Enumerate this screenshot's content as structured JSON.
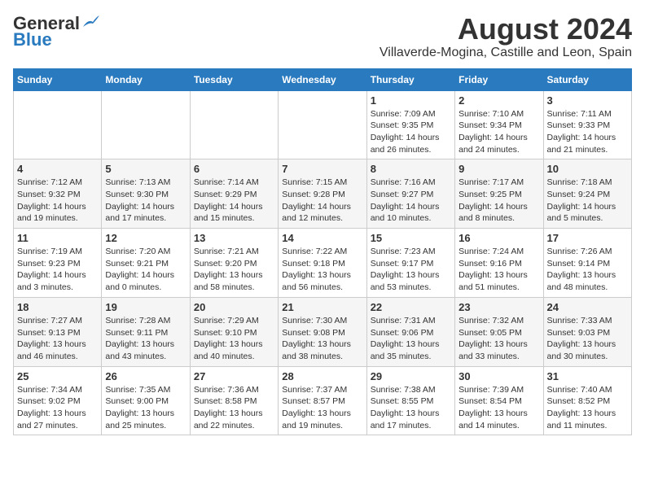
{
  "logo": {
    "general": "General",
    "blue": "Blue"
  },
  "title": "August 2024",
  "subtitle": "Villaverde-Mogina, Castille and Leon, Spain",
  "days_of_week": [
    "Sunday",
    "Monday",
    "Tuesday",
    "Wednesday",
    "Thursday",
    "Friday",
    "Saturday"
  ],
  "weeks": [
    [
      {
        "day": "",
        "info": ""
      },
      {
        "day": "",
        "info": ""
      },
      {
        "day": "",
        "info": ""
      },
      {
        "day": "",
        "info": ""
      },
      {
        "day": "1",
        "info": "Sunrise: 7:09 AM\nSunset: 9:35 PM\nDaylight: 14 hours and 26 minutes."
      },
      {
        "day": "2",
        "info": "Sunrise: 7:10 AM\nSunset: 9:34 PM\nDaylight: 14 hours and 24 minutes."
      },
      {
        "day": "3",
        "info": "Sunrise: 7:11 AM\nSunset: 9:33 PM\nDaylight: 14 hours and 21 minutes."
      }
    ],
    [
      {
        "day": "4",
        "info": "Sunrise: 7:12 AM\nSunset: 9:32 PM\nDaylight: 14 hours and 19 minutes."
      },
      {
        "day": "5",
        "info": "Sunrise: 7:13 AM\nSunset: 9:30 PM\nDaylight: 14 hours and 17 minutes."
      },
      {
        "day": "6",
        "info": "Sunrise: 7:14 AM\nSunset: 9:29 PM\nDaylight: 14 hours and 15 minutes."
      },
      {
        "day": "7",
        "info": "Sunrise: 7:15 AM\nSunset: 9:28 PM\nDaylight: 14 hours and 12 minutes."
      },
      {
        "day": "8",
        "info": "Sunrise: 7:16 AM\nSunset: 9:27 PM\nDaylight: 14 hours and 10 minutes."
      },
      {
        "day": "9",
        "info": "Sunrise: 7:17 AM\nSunset: 9:25 PM\nDaylight: 14 hours and 8 minutes."
      },
      {
        "day": "10",
        "info": "Sunrise: 7:18 AM\nSunset: 9:24 PM\nDaylight: 14 hours and 5 minutes."
      }
    ],
    [
      {
        "day": "11",
        "info": "Sunrise: 7:19 AM\nSunset: 9:23 PM\nDaylight: 14 hours and 3 minutes."
      },
      {
        "day": "12",
        "info": "Sunrise: 7:20 AM\nSunset: 9:21 PM\nDaylight: 14 hours and 0 minutes."
      },
      {
        "day": "13",
        "info": "Sunrise: 7:21 AM\nSunset: 9:20 PM\nDaylight: 13 hours and 58 minutes."
      },
      {
        "day": "14",
        "info": "Sunrise: 7:22 AM\nSunset: 9:18 PM\nDaylight: 13 hours and 56 minutes."
      },
      {
        "day": "15",
        "info": "Sunrise: 7:23 AM\nSunset: 9:17 PM\nDaylight: 13 hours and 53 minutes."
      },
      {
        "day": "16",
        "info": "Sunrise: 7:24 AM\nSunset: 9:16 PM\nDaylight: 13 hours and 51 minutes."
      },
      {
        "day": "17",
        "info": "Sunrise: 7:26 AM\nSunset: 9:14 PM\nDaylight: 13 hours and 48 minutes."
      }
    ],
    [
      {
        "day": "18",
        "info": "Sunrise: 7:27 AM\nSunset: 9:13 PM\nDaylight: 13 hours and 46 minutes."
      },
      {
        "day": "19",
        "info": "Sunrise: 7:28 AM\nSunset: 9:11 PM\nDaylight: 13 hours and 43 minutes."
      },
      {
        "day": "20",
        "info": "Sunrise: 7:29 AM\nSunset: 9:10 PM\nDaylight: 13 hours and 40 minutes."
      },
      {
        "day": "21",
        "info": "Sunrise: 7:30 AM\nSunset: 9:08 PM\nDaylight: 13 hours and 38 minutes."
      },
      {
        "day": "22",
        "info": "Sunrise: 7:31 AM\nSunset: 9:06 PM\nDaylight: 13 hours and 35 minutes."
      },
      {
        "day": "23",
        "info": "Sunrise: 7:32 AM\nSunset: 9:05 PM\nDaylight: 13 hours and 33 minutes."
      },
      {
        "day": "24",
        "info": "Sunrise: 7:33 AM\nSunset: 9:03 PM\nDaylight: 13 hours and 30 minutes."
      }
    ],
    [
      {
        "day": "25",
        "info": "Sunrise: 7:34 AM\nSunset: 9:02 PM\nDaylight: 13 hours and 27 minutes."
      },
      {
        "day": "26",
        "info": "Sunrise: 7:35 AM\nSunset: 9:00 PM\nDaylight: 13 hours and 25 minutes."
      },
      {
        "day": "27",
        "info": "Sunrise: 7:36 AM\nSunset: 8:58 PM\nDaylight: 13 hours and 22 minutes."
      },
      {
        "day": "28",
        "info": "Sunrise: 7:37 AM\nSunset: 8:57 PM\nDaylight: 13 hours and 19 minutes."
      },
      {
        "day": "29",
        "info": "Sunrise: 7:38 AM\nSunset: 8:55 PM\nDaylight: 13 hours and 17 minutes."
      },
      {
        "day": "30",
        "info": "Sunrise: 7:39 AM\nSunset: 8:54 PM\nDaylight: 13 hours and 14 minutes."
      },
      {
        "day": "31",
        "info": "Sunrise: 7:40 AM\nSunset: 8:52 PM\nDaylight: 13 hours and 11 minutes."
      }
    ]
  ]
}
